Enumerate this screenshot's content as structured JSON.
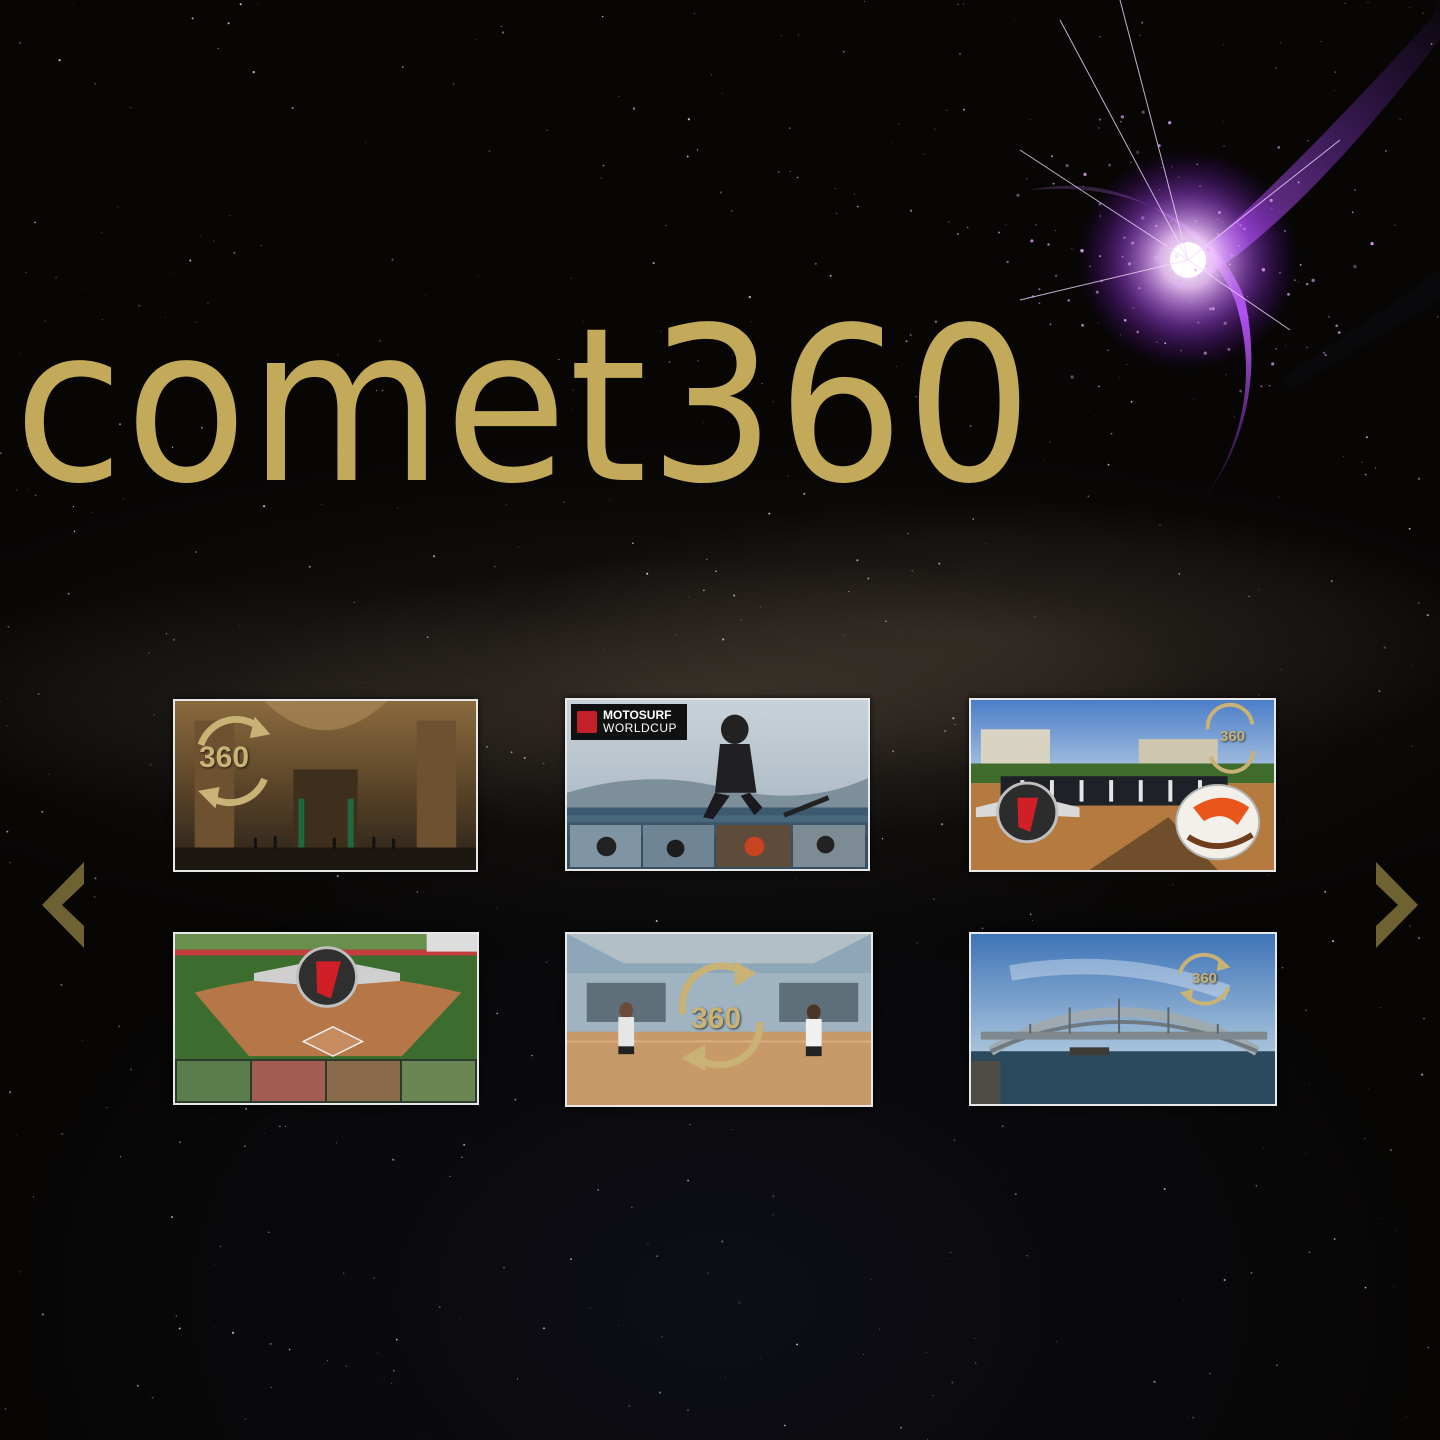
{
  "brand": {
    "logo_text": "comet360",
    "color": "#c2aa5a"
  },
  "carousel": {
    "prev_icon": "chevron-left-icon",
    "next_icon": "chevron-right-icon",
    "arrow_color": "#6e6232",
    "tiles": [
      {
        "id": "cathedral",
        "badge": "360",
        "scene": "cathedral interior panorama"
      },
      {
        "id": "motosurf",
        "brand_line1": "MOTOSURF",
        "brand_line2": "WORLDCUP",
        "scene": "motosurf rider jumping"
      },
      {
        "id": "baseball-eagles",
        "badge": "360",
        "scene": "baseball teams lined up on field"
      },
      {
        "id": "softball",
        "scene": "softball field with racers logo"
      },
      {
        "id": "dance-studio",
        "badge": "360",
        "scene": "dance studio panorama"
      },
      {
        "id": "bridge",
        "badge": "360",
        "scene": "river bridge panorama"
      }
    ]
  }
}
